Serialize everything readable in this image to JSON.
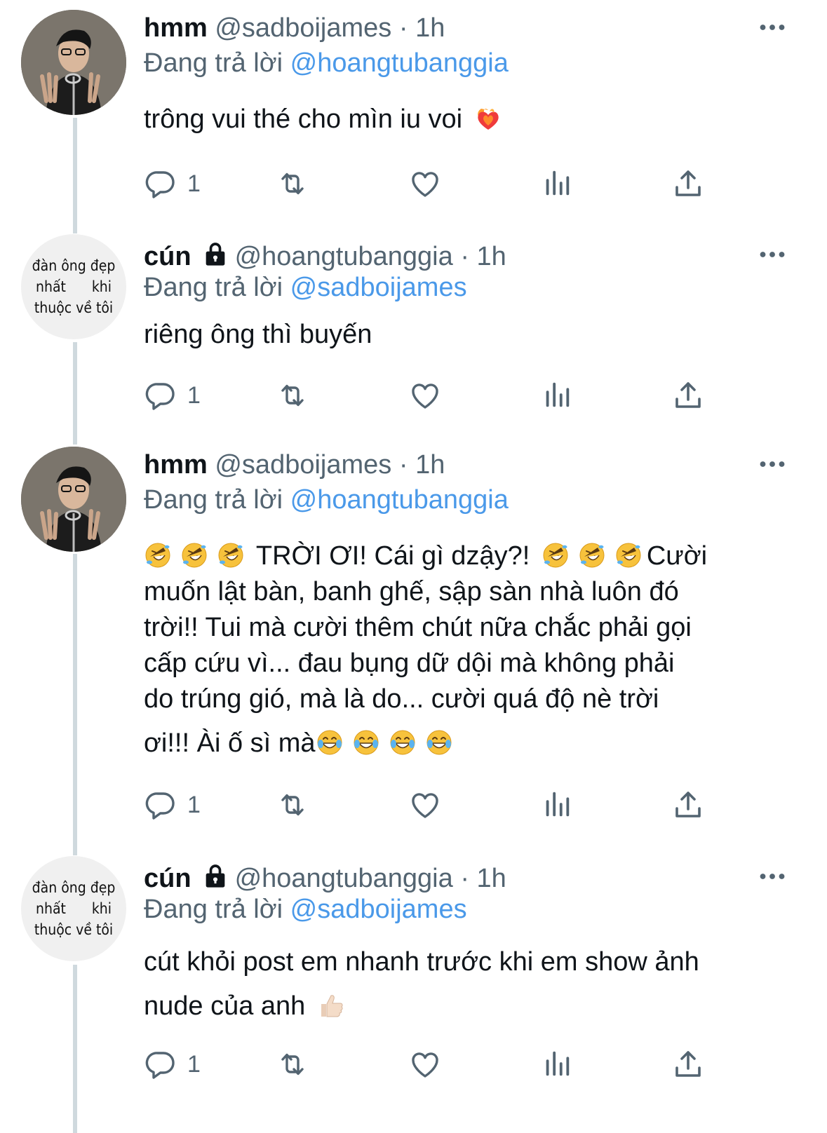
{
  "tweets": [
    {
      "name": "hmm",
      "handle": "@sadboijames",
      "sep": "·",
      "time": "1h",
      "replying_prefix": "Đang trả lời",
      "replying_to": "@hoangtubanggia",
      "text": "trông vui thé cho mìn iu voi",
      "emoji": "heart-on-fire-emoji",
      "reply_count": "1"
    },
    {
      "name": "cún",
      "handle": "@hoangtubanggia",
      "sep": "·",
      "time": "1h",
      "replying_prefix": "Đang trả lời",
      "replying_to": "@sadboijames",
      "text": "riêng ông thì buyến",
      "avatar_text": {
        "line1": "đàn ông đẹp",
        "line2a": "nhất",
        "line2b": "khi",
        "line3": "thuộc về tôi"
      },
      "reply_count": "1"
    },
    {
      "name": "hmm",
      "handle": "@sadboijames",
      "sep": "·",
      "time": "1h",
      "replying_prefix": "Đang trả lời",
      "replying_to": "@hoangtubanggia",
      "text_part1": "TRỜI ƠI! Cái gì dzậy?!",
      "text_part2": "Cười",
      "text_line2": "muốn lật bàn, banh ghế, sập sàn nhà luôn đó",
      "text_line3": "trời!! Tui mà cười thêm chút nữa chắc phải gọi",
      "text_line4": "cấp cứu vì... đau bụng dữ dội mà không phải",
      "text_line5": "do trúng gió, mà là do... cười quá độ nè trời",
      "text_line6": "ơi!!! Ài ố sì mà",
      "emoji_a": "rolling-laughing-emoji",
      "emoji_b": "tears-of-joy-emoji",
      "reply_count": "1"
    },
    {
      "name": "cún",
      "handle": "@hoangtubanggia",
      "sep": "·",
      "time": "1h",
      "replying_prefix": "Đang trả lời",
      "replying_to": "@sadboijames",
      "text_line1": "cút khỏi post em nhanh trước khi em show ảnh",
      "text_line2": "nude của anh",
      "emoji": "thumbs-up-emoji",
      "avatar_text": {
        "line1": "đàn ông đẹp",
        "line2a": "nhất",
        "line2b": "khi",
        "line3": "thuộc về tôi"
      },
      "reply_count": "1"
    }
  ],
  "colors": {
    "accent": "#4a99e9",
    "muted": "#536471",
    "thread_line": "#cfd9de"
  },
  "icons": [
    "reply-icon",
    "retweet-icon",
    "like-icon",
    "views-icon",
    "share-icon",
    "more-icon",
    "lock-icon"
  ]
}
